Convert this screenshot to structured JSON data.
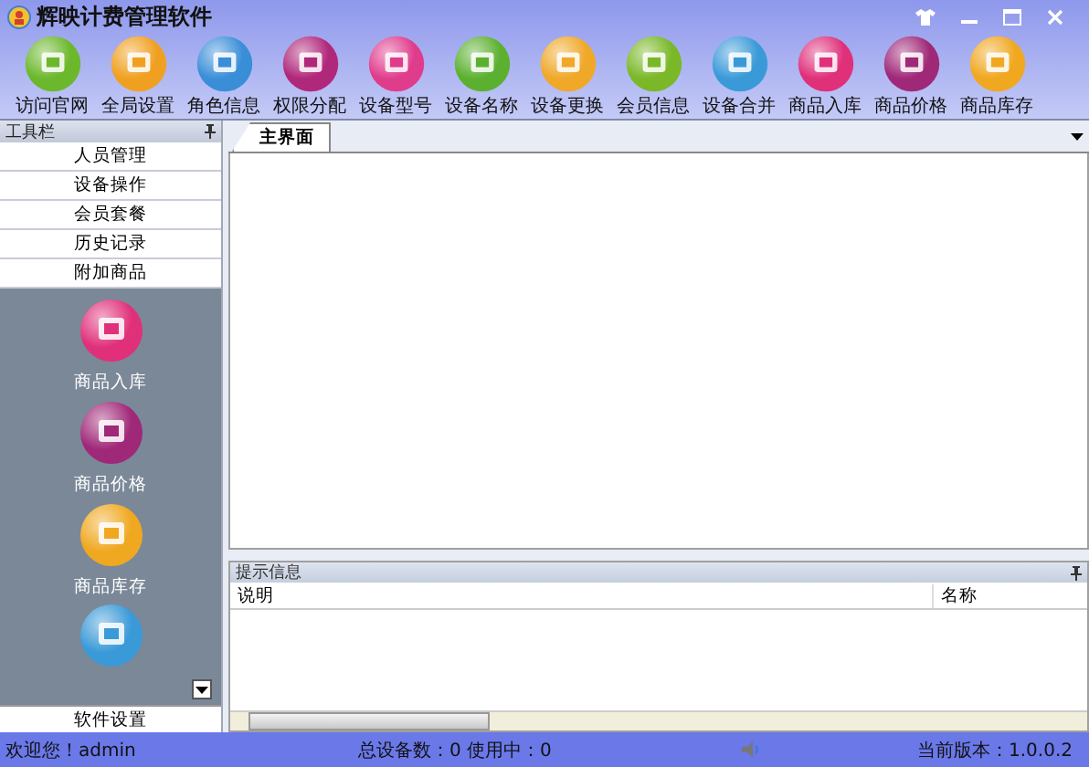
{
  "window": {
    "title": "辉映计费管理软件"
  },
  "toolbar": [
    {
      "label": "访问官网",
      "color": "#6cb82c"
    },
    {
      "label": "全局设置",
      "color": "#f0a020"
    },
    {
      "label": "角色信息",
      "color": "#3a8ed8"
    },
    {
      "label": "权限分配",
      "color": "#b0287a"
    },
    {
      "label": "设备型号",
      "color": "#e03c8c"
    },
    {
      "label": "设备名称",
      "color": "#5cb030"
    },
    {
      "label": "设备更换",
      "color": "#f0a828"
    },
    {
      "label": "会员信息",
      "color": "#7ab828"
    },
    {
      "label": "设备合并",
      "color": "#3a9ad8"
    },
    {
      "label": "商品入库",
      "color": "#e0307a"
    },
    {
      "label": "商品价格",
      "color": "#a02878"
    },
    {
      "label": "商品库存",
      "color": "#f0a820"
    }
  ],
  "sidebar": {
    "title": "工具栏",
    "categories": [
      "人员管理",
      "设备操作",
      "会员套餐",
      "历史记录",
      "附加商品"
    ],
    "panel_items": [
      {
        "label": "商品入库",
        "color": "#e0307a"
      },
      {
        "label": "商品价格",
        "color": "#a02878"
      },
      {
        "label": "商品库存",
        "color": "#f0a820"
      },
      {
        "color": "#3a9ad8"
      }
    ],
    "footer": "软件设置"
  },
  "tabs": [
    {
      "label": "主界面",
      "selected": true
    }
  ],
  "info_panel": {
    "title": "提示信息",
    "columns": [
      "说明",
      "名称"
    ]
  },
  "status_bar": {
    "welcome": "欢迎您！admin",
    "devices": "总设备数：0 使用中：0",
    "version": "当前版本：1.0.0.2"
  }
}
